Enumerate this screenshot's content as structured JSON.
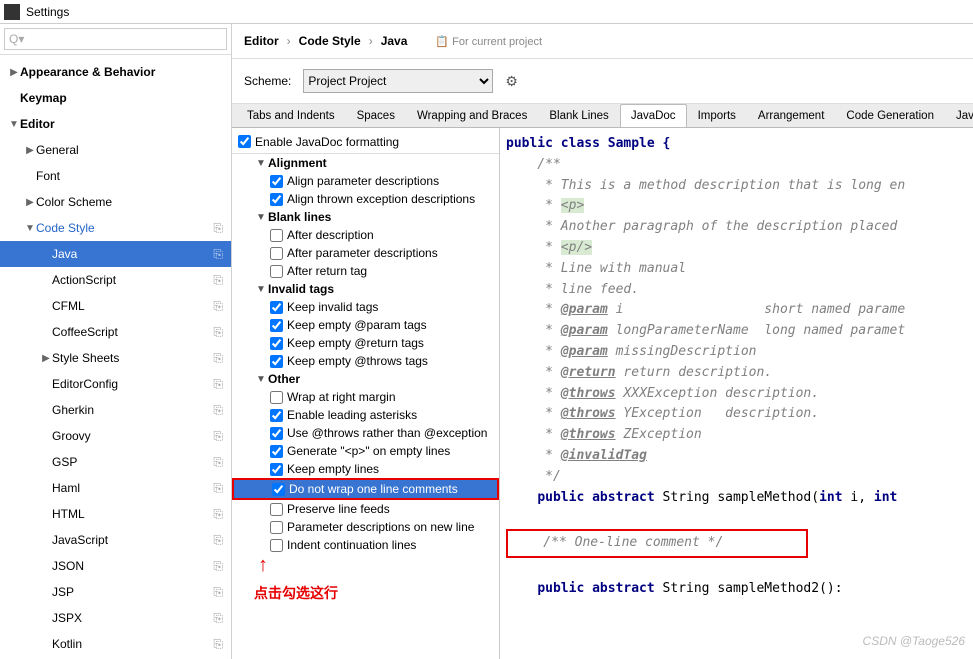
{
  "window": {
    "title": "Settings"
  },
  "search": {
    "placeholder": ""
  },
  "sidebar": {
    "items": [
      {
        "label": "Appearance & Behavior",
        "indent": 0,
        "arrow": "▶",
        "bold": true
      },
      {
        "label": "Keymap",
        "indent": 0,
        "arrow": "",
        "bold": true
      },
      {
        "label": "Editor",
        "indent": 0,
        "arrow": "▼",
        "bold": true
      },
      {
        "label": "General",
        "indent": 1,
        "arrow": "▶"
      },
      {
        "label": "Font",
        "indent": 1,
        "arrow": ""
      },
      {
        "label": "Color Scheme",
        "indent": 1,
        "arrow": "▶"
      },
      {
        "label": "Code Style",
        "indent": 1,
        "arrow": "▼",
        "link": true,
        "copy": true
      },
      {
        "label": "Java",
        "indent": 2,
        "arrow": "",
        "selected": true,
        "copy": true
      },
      {
        "label": "ActionScript",
        "indent": 2,
        "arrow": "",
        "copy": true
      },
      {
        "label": "CFML",
        "indent": 2,
        "arrow": "",
        "copy": true
      },
      {
        "label": "CoffeeScript",
        "indent": 2,
        "arrow": "",
        "copy": true
      },
      {
        "label": "Style Sheets",
        "indent": 2,
        "arrow": "▶",
        "copy": true
      },
      {
        "label": "EditorConfig",
        "indent": 2,
        "arrow": "",
        "copy": true
      },
      {
        "label": "Gherkin",
        "indent": 2,
        "arrow": "",
        "copy": true
      },
      {
        "label": "Groovy",
        "indent": 2,
        "arrow": "",
        "copy": true
      },
      {
        "label": "GSP",
        "indent": 2,
        "arrow": "",
        "copy": true
      },
      {
        "label": "Haml",
        "indent": 2,
        "arrow": "",
        "copy": true
      },
      {
        "label": "HTML",
        "indent": 2,
        "arrow": "",
        "copy": true
      },
      {
        "label": "JavaScript",
        "indent": 2,
        "arrow": "",
        "copy": true
      },
      {
        "label": "JSON",
        "indent": 2,
        "arrow": "",
        "copy": true
      },
      {
        "label": "JSP",
        "indent": 2,
        "arrow": "",
        "copy": true
      },
      {
        "label": "JSPX",
        "indent": 2,
        "arrow": "",
        "copy": true
      },
      {
        "label": "Kotlin",
        "indent": 2,
        "arrow": "",
        "copy": true
      }
    ]
  },
  "breadcrumb": [
    "Editor",
    "Code Style",
    "Java"
  ],
  "project_msg": "For current project",
  "scheme": {
    "label": "Scheme:",
    "value": "Project  Project"
  },
  "tabs": [
    "Tabs and Indents",
    "Spaces",
    "Wrapping and Braces",
    "Blank Lines",
    "JavaDoc",
    "Imports",
    "Arrangement",
    "Code Generation",
    "Java EE Na"
  ],
  "active_tab": 4,
  "options": {
    "enable": {
      "label": "Enable JavaDoc formatting",
      "checked": true
    },
    "groups": [
      {
        "name": "Alignment",
        "items": [
          {
            "label": "Align parameter descriptions",
            "checked": true
          },
          {
            "label": "Align thrown exception descriptions",
            "checked": true
          }
        ]
      },
      {
        "name": "Blank lines",
        "items": [
          {
            "label": "After description",
            "checked": false
          },
          {
            "label": "After parameter descriptions",
            "checked": false
          },
          {
            "label": "After return tag",
            "checked": false
          }
        ]
      },
      {
        "name": "Invalid tags",
        "items": [
          {
            "label": "Keep invalid tags",
            "checked": true
          },
          {
            "label": "Keep empty @param tags",
            "checked": true
          },
          {
            "label": "Keep empty @return tags",
            "checked": true
          },
          {
            "label": "Keep empty @throws tags",
            "checked": true
          }
        ]
      },
      {
        "name": "Other",
        "items": [
          {
            "label": "Wrap at right margin",
            "checked": false
          },
          {
            "label": "Enable leading asterisks",
            "checked": true
          },
          {
            "label": "Use @throws rather than @exception",
            "checked": true
          },
          {
            "label": "Generate \"<p>\" on empty lines",
            "checked": true
          },
          {
            "label": "Keep empty lines",
            "checked": true
          },
          {
            "label": "Do not wrap one line comments",
            "checked": true,
            "selected": true,
            "highlight": true
          },
          {
            "label": "Preserve line feeds",
            "checked": false
          },
          {
            "label": "Parameter descriptions on new line",
            "checked": false
          },
          {
            "label": "Indent continuation lines",
            "checked": false
          }
        ]
      }
    ]
  },
  "annotation": "点击勾选这行",
  "preview": {
    "l1": "public class Sample {",
    "l2": "    /**",
    "l3": "     * This is a method description that is long en",
    "l4a": "     * ",
    "l4b": "<p>",
    "l5": "     * Another paragraph of the description placed ",
    "l6a": "     * ",
    "l6b": "<p/>",
    "l7": "     * Line with manual",
    "l8": "     * line feed.",
    "l9a": "     * ",
    "l9b": "@param",
    "l9c": " i                  short named parame",
    "l10a": "     * ",
    "l10b": "@param",
    "l10c": " longParameterName  long named paramet",
    "l11a": "     * ",
    "l11b": "@param",
    "l11c": " missingDescription",
    "l12a": "     * ",
    "l12b": "@return",
    "l12c": " return description.",
    "l13a": "     * ",
    "l13b": "@throws",
    "l13c": " XXXException description.",
    "l14a": "     * ",
    "l14b": "@throws",
    "l14c": " YException   description.",
    "l15a": "     * ",
    "l15b": "@throws",
    "l15c": " ZException",
    "l16a": "     * ",
    "l16b": "@invalidTag",
    "l17": "     */",
    "l18a": "    ",
    "l18b": "public abstract",
    "l18c": " String sampleMethod(",
    "l18d": "int",
    "l18e": " i, ",
    "l18f": "int",
    "l19": "    /** One-line comment */",
    "l20a": "    ",
    "l20b": "public abstract",
    "l20c": " String sampleMethod2():"
  },
  "watermark": "CSDN @Taoge526"
}
